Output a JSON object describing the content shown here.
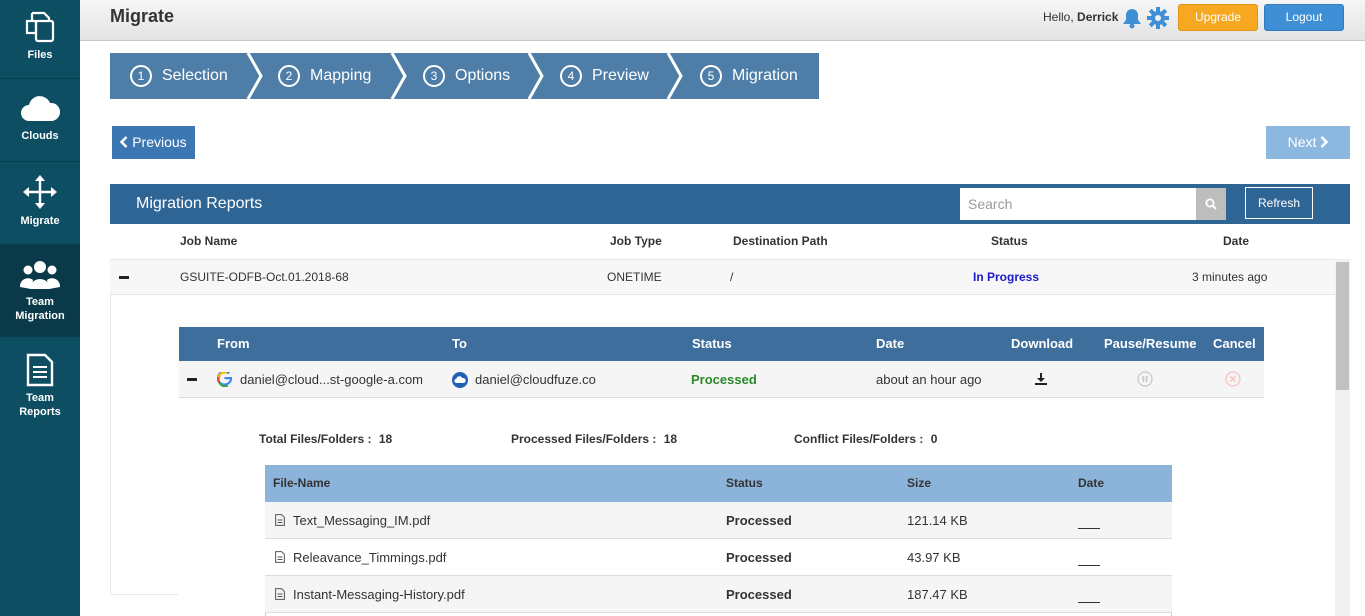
{
  "sidebar": {
    "items": [
      {
        "label": "Files",
        "icon": "files-icon"
      },
      {
        "label": "Clouds",
        "icon": "cloud-icon"
      },
      {
        "label": "Migrate",
        "icon": "move-arrows-icon"
      },
      {
        "label1": "Team",
        "label2": "Migration",
        "icon": "team-icon"
      },
      {
        "label1": "Team",
        "label2": "Reports",
        "icon": "report-icon"
      }
    ]
  },
  "header": {
    "title": "Migrate",
    "greeting": "Hello,",
    "user": "Derrick",
    "upgrade_label": "Upgrade",
    "logout_label": "Logout"
  },
  "steps": [
    {
      "num": "1",
      "label": "Selection"
    },
    {
      "num": "2",
      "label": "Mapping"
    },
    {
      "num": "3",
      "label": "Options"
    },
    {
      "num": "4",
      "label": "Preview"
    },
    {
      "num": "5",
      "label": "Migration"
    }
  ],
  "nav": {
    "previous_label": "Previous",
    "next_label": "Next"
  },
  "reports": {
    "title": "Migration Reports",
    "search_placeholder": "Search",
    "refresh_label": "Refresh"
  },
  "job_table": {
    "columns": [
      "Job Name",
      "Job Type",
      "Destination Path",
      "Status",
      "Date"
    ],
    "row": {
      "name": "GSUITE-ODFB-Oct.01.2018-68",
      "type": "ONETIME",
      "path": "/",
      "status": "In Progress",
      "date": "3 minutes ago"
    }
  },
  "migration_table": {
    "columns": [
      "From",
      "To",
      "Status",
      "Date",
      "Download",
      "Pause/Resume",
      "Cancel"
    ],
    "row": {
      "from": "daniel@cloud...st-google-a.com",
      "to": "daniel@cloudfuze.co",
      "status": "Processed",
      "date": "about an hour ago"
    }
  },
  "summary": {
    "total_label": "Total Files/Folders :",
    "total_value": "18",
    "processed_label": "Processed Files/Folders :",
    "processed_value": "18",
    "conflict_label": "Conflict Files/Folders :",
    "conflict_value": "0"
  },
  "file_table": {
    "columns": [
      "File-Name",
      "Status",
      "Size",
      "Date"
    ],
    "rows": [
      {
        "name": "Text_Messaging_IM.pdf",
        "status": "Processed",
        "size": "121.14 KB"
      },
      {
        "name": "Releavance_Timmings.pdf",
        "status": "Processed",
        "size": "43.97 KB"
      },
      {
        "name": "Instant-Messaging-History.pdf",
        "status": "Processed",
        "size": "187.47 KB"
      }
    ]
  },
  "colors": {
    "sidebar": "#0d4e63",
    "accent": "#2e6595",
    "upgrade": "#f6a821",
    "logout": "#3e8fd6",
    "in_progress": "#1a1ac8",
    "processed": "#2a8a2a"
  }
}
